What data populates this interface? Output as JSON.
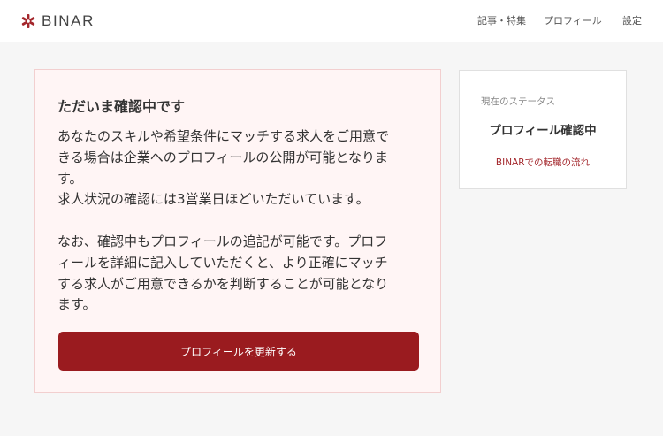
{
  "header": {
    "logo_text": "BINAR",
    "nav": [
      {
        "label": "記事・特集"
      },
      {
        "label": "プロフィール"
      },
      {
        "label": "設定"
      }
    ]
  },
  "notice": {
    "title": "ただいま確認中です",
    "lines": [
      "あなたのスキルや希望条件にマッチする求人をご用意で",
      "きる場合は企業へのプロフィールの公開が可能となりま",
      "す。",
      "求人状況の確認には3営業日ほどいただいています。",
      "なお、確認中もプロフィールの追記が可能です。プロフ",
      "ィールを詳細に記入していただくと、より正確にマッチ",
      "する求人がご用意できるかを判断することが可能となり",
      "ます。"
    ],
    "button_label": "プロフィールを更新する"
  },
  "status": {
    "label": "現在のステータス",
    "value": "プロフィール確認中",
    "link_label": "BINARでの転職の流れ"
  },
  "colors": {
    "accent": "#9a1b1f",
    "notice_bg": "#fff5f5",
    "notice_border": "#f2cfcf",
    "link": "#a3262b"
  },
  "icons": {
    "logo": "binar-asterisk-logo-icon"
  }
}
